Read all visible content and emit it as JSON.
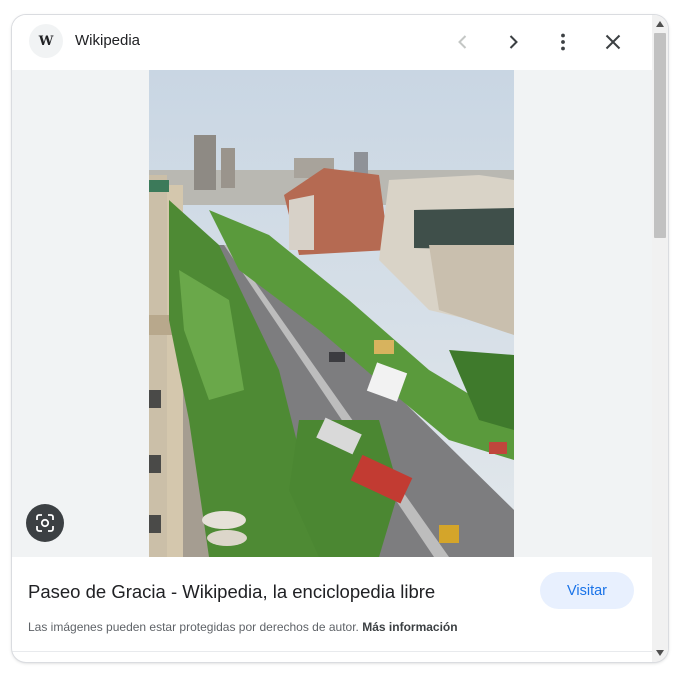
{
  "header": {
    "site_initial": "W",
    "site_name": "Wikipedia",
    "icons": [
      "chevron-left-icon",
      "chevron-right-icon",
      "more-vert-icon",
      "close-icon"
    ]
  },
  "image": {
    "lens_icon": "google-lens-icon"
  },
  "result": {
    "title": "Paseo de Gracia - Wikipedia, la enciclopedia libre",
    "visit_label": "Visitar",
    "copyright_text": "Las imágenes pueden estar protegidas por derechos de autor.",
    "more_info_label": "Más información"
  },
  "colors": {
    "accent": "#1a73e8",
    "visit_bg": "#e8f0fe",
    "panel_bg": "#f1f3f4"
  }
}
